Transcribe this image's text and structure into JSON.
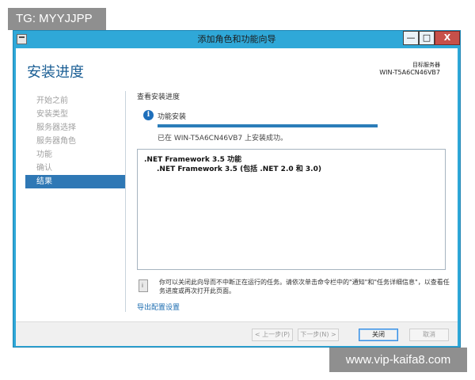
{
  "overlays": {
    "tg_badge": "TG: MYYJJPP",
    "watermark": "www.vip-kaifa8.com"
  },
  "window": {
    "title": "添加角色和功能向导",
    "controls": {
      "minimize": "—",
      "maximize": "□",
      "close": "X"
    }
  },
  "header": {
    "page_title": "安装进度",
    "target_label": "目标服务器",
    "target_name": "WIN-T5A6CN46VB7"
  },
  "nav": {
    "items": [
      {
        "label": "开始之前",
        "active": false
      },
      {
        "label": "安装类型",
        "active": false
      },
      {
        "label": "服务器选择",
        "active": false
      },
      {
        "label": "服务器角色",
        "active": false
      },
      {
        "label": "功能",
        "active": false
      },
      {
        "label": "确认",
        "active": false
      },
      {
        "label": "结果",
        "active": true
      }
    ]
  },
  "main": {
    "section_title": "查看安装进度",
    "status_label": "功能安装",
    "progress_fraction": 1.0,
    "success_message": "已在 WIN-T5A6CN46VB7 上安装成功。",
    "results": [
      ".NET Framework 3.5 功能",
      ".NET Framework 3.5 (包括 .NET 2.0 和 3.0)"
    ],
    "note": "你可以关闭此向导而不中断正在运行的任务。请依次单击命令栏中的\"通知\"和\"任务详细信息\"，以查看任务进度或再次打开此页面。",
    "export_link": "导出配置设置"
  },
  "footer": {
    "prev_label": "< 上一步(P)",
    "next_label": "下一步(N) >",
    "close_label": "关闭",
    "cancel_label": "取消"
  },
  "colors": {
    "window_frame": "#2fa8d8",
    "page_title": "#1b5f95",
    "nav_active": "#2f78b5",
    "progress": "#2b7db9",
    "link": "#1b6cb0"
  }
}
